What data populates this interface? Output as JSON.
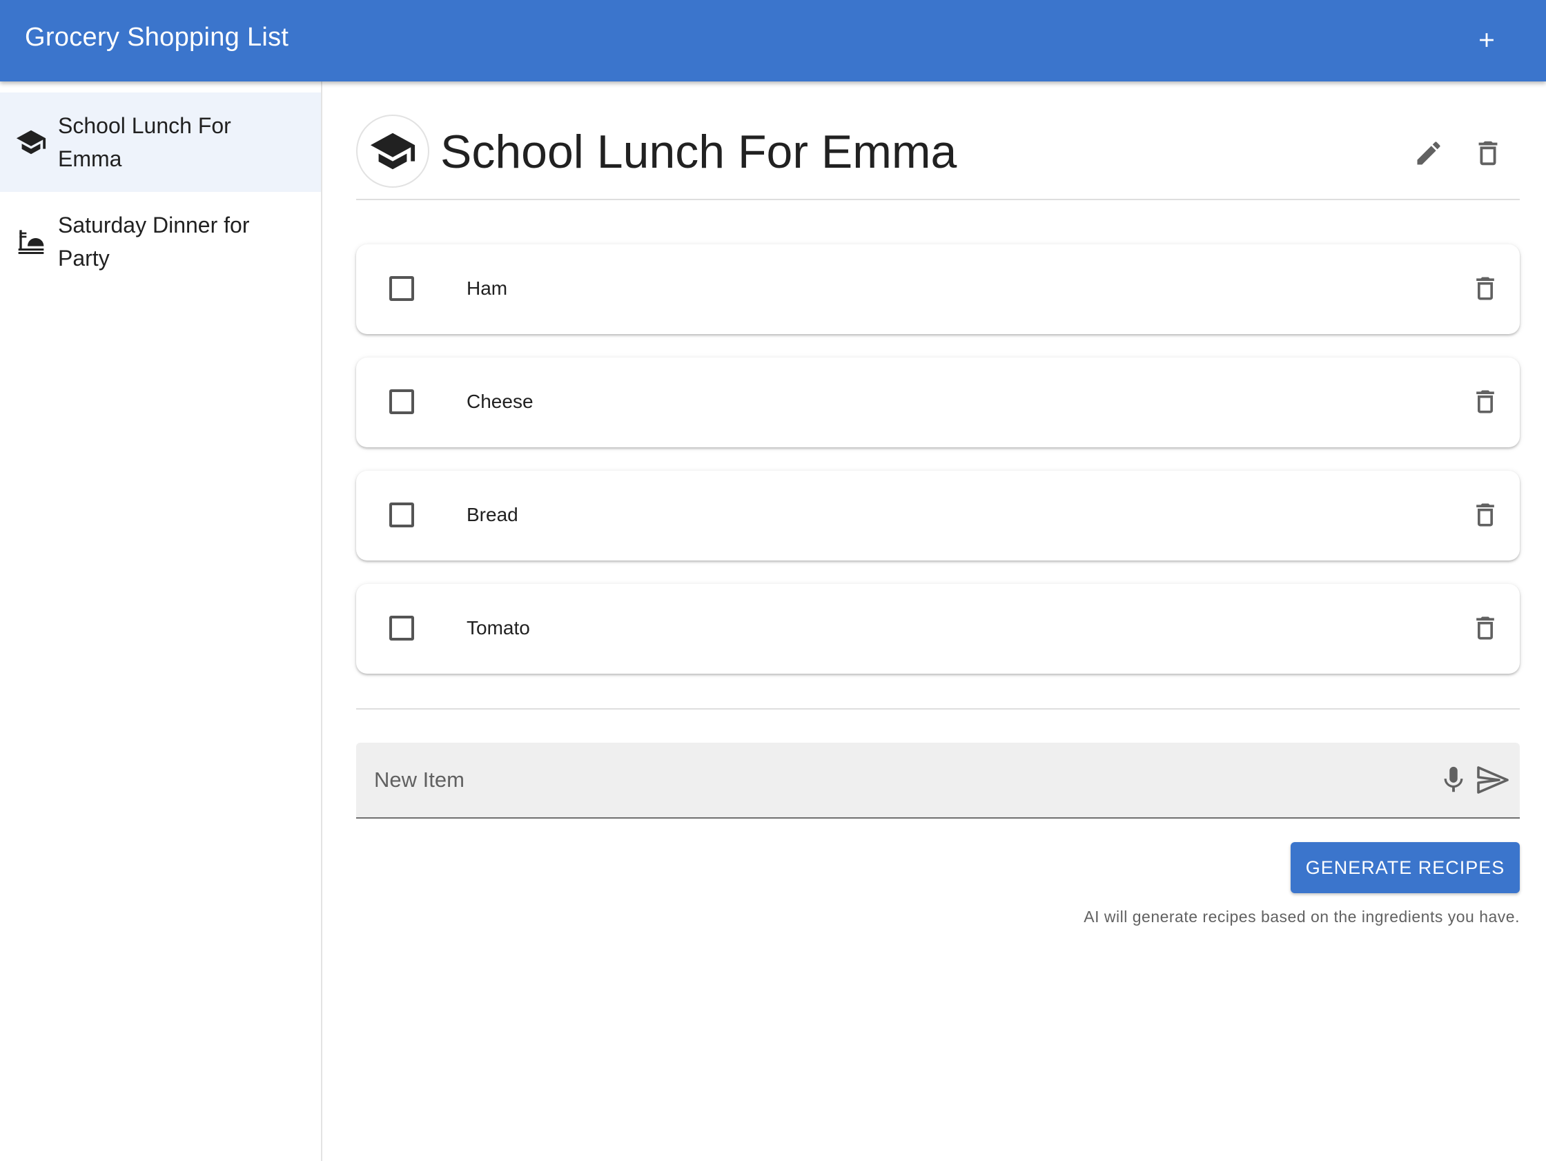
{
  "app": {
    "title": "Grocery Shopping List",
    "accent_color": "#3b75cc",
    "add_icon": "plus-icon"
  },
  "sidebar": {
    "items": [
      {
        "label": "School Lunch For Emma",
        "icon": "graduation-cap-icon",
        "selected": true
      },
      {
        "label": "Saturday Dinner for Party",
        "icon": "dinner-icon",
        "selected": false
      }
    ]
  },
  "main": {
    "header": {
      "title": "School Lunch For Emma",
      "avatar_icon": "graduation-cap-icon",
      "edit_icon": "pencil-icon",
      "delete_icon": "trash-icon"
    },
    "items": [
      {
        "label": "Ham",
        "checked": false
      },
      {
        "label": "Cheese",
        "checked": false
      },
      {
        "label": "Bread",
        "checked": false
      },
      {
        "label": "Tomato",
        "checked": false
      }
    ],
    "new_item": {
      "placeholder": "New Item",
      "value": "",
      "mic_icon": "microphone-icon",
      "send_icon": "send-icon"
    },
    "generate": {
      "button_label": "GENERATE RECIPES",
      "helper_text": "AI will generate recipes based on the ingredients you have."
    }
  }
}
